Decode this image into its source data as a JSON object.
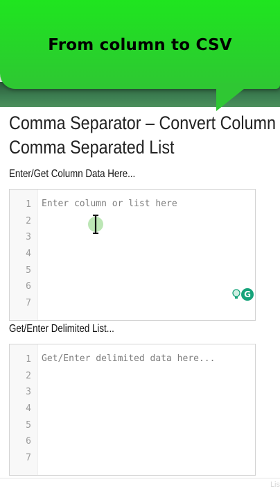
{
  "banner": {
    "title": "From column to CSV",
    "color": "#27d42a"
  },
  "page": {
    "title_line1": "Comma Separator – Convert Column to",
    "title_line2": "Comma Separated List"
  },
  "input_section": {
    "label": "Enter/Get Column Data Here...",
    "placeholder": "Enter column or list here",
    "line_numbers": [
      "1",
      "2",
      "3",
      "4",
      "5",
      "6",
      "7"
    ]
  },
  "output_section": {
    "label": "Get/Enter Delimited List...",
    "placeholder": "Get/Enter delimited data here...",
    "line_numbers": [
      "1",
      "2",
      "3",
      "4",
      "5",
      "6",
      "7"
    ]
  },
  "grammarly": {
    "badge_letter": "G",
    "color": "#16a37a"
  },
  "corner": {
    "text": "Lis"
  }
}
